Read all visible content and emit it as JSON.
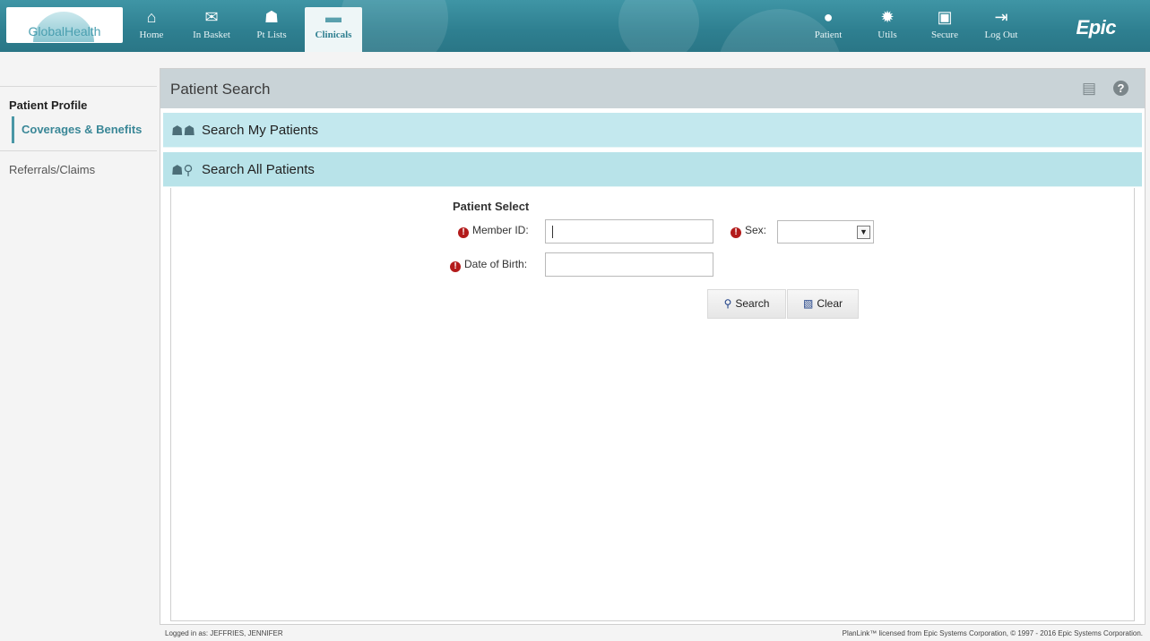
{
  "app": {
    "logo_text": "GlobalHealth",
    "brand": "Epic",
    "accent_color": "#2e7f90"
  },
  "nav_left": [
    {
      "label": "Home",
      "icon": "home-icon"
    },
    {
      "label": "In Basket",
      "icon": "mail-icon"
    },
    {
      "label": "Pt Lists",
      "icon": "people-icon"
    },
    {
      "label": "Clinicals",
      "icon": "folder-icon",
      "active": true
    }
  ],
  "nav_right": [
    {
      "label": "Patient",
      "icon": "person-icon"
    },
    {
      "label": "Utils",
      "icon": "gear-icon"
    },
    {
      "label": "Secure",
      "icon": "lock-icon"
    },
    {
      "label": "Log Out",
      "icon": "logout-icon"
    }
  ],
  "sidebar": {
    "heading": "Patient Profile",
    "active_item": "Coverages & Benefits",
    "item": "Referrals/Claims"
  },
  "page": {
    "title": "Patient Search"
  },
  "sections": {
    "my_patients": "Search My Patients",
    "all_patients": "Search All Patients"
  },
  "form": {
    "title": "Patient Select",
    "member_id_label": "Member ID:",
    "member_id_value": "",
    "sex_label": "Sex:",
    "sex_value": "",
    "dob_label": "Date of Birth:",
    "dob_value": "",
    "search_label": "Search",
    "clear_label": "Clear"
  },
  "footer": {
    "logged_in": "Logged in as: JEFFRIES, JENNIFER",
    "copyright": "PlanLink™ licensed from Epic Systems Corporation, © 1997 - 2016 Epic Systems Corporation."
  }
}
